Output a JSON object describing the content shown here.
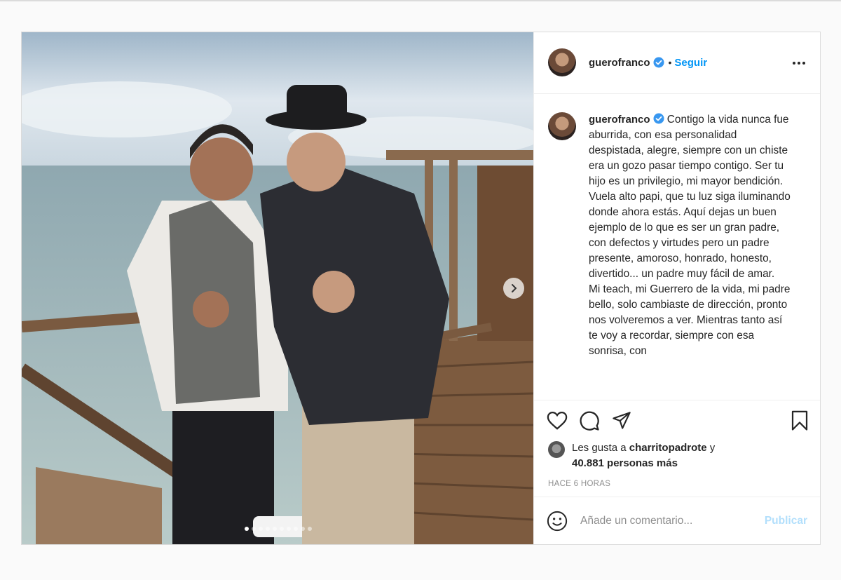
{
  "post": {
    "username": "guerofranco",
    "follow_label": "Seguir",
    "separator": "•",
    "caption": "Contigo la vida nunca fue aburrida, con esa personalidad despistada, alegre, siempre con un chiste era un gozo pasar tiempo contigo. Ser tu hijo es un privilegio, mi mayor bendición. Vuela alto papi, que tu luz siga iluminando donde ahora estás. Aquí dejas un buen ejemplo de lo que es ser un gran padre, con defectos y virtudes pero un padre presente, amoroso, honrado, honesto, divertido... un padre muy fácil de amar.\nMi teach, mi Guerrero de la vida, mi padre bello, solo cambiaste de dirección, pronto nos volveremos a ver. Mientras tanto así te voy a recordar, siempre con esa sonrisa, con",
    "likes_prefix": "Les gusta a",
    "liked_by": "charritopadrote",
    "likes_connector": "y",
    "likes_count": "40.881 personas más",
    "timestamp": "HACE 6 HORAS",
    "comment_placeholder": "Añade un comentario...",
    "publish_label": "Publicar"
  },
  "carousel": {
    "total_images": 10,
    "active_index": 0
  },
  "icons": {
    "verified": "verified-badge-icon",
    "more": "more-options-icon",
    "like": "heart-icon",
    "comment": "comment-icon",
    "share": "share-icon",
    "save": "bookmark-icon",
    "emoji": "emoji-icon",
    "next": "chevron-right-icon"
  },
  "colors": {
    "accent": "#0095f6",
    "publish_disabled": "#b2dffc",
    "muted": "#8e8e8e"
  }
}
